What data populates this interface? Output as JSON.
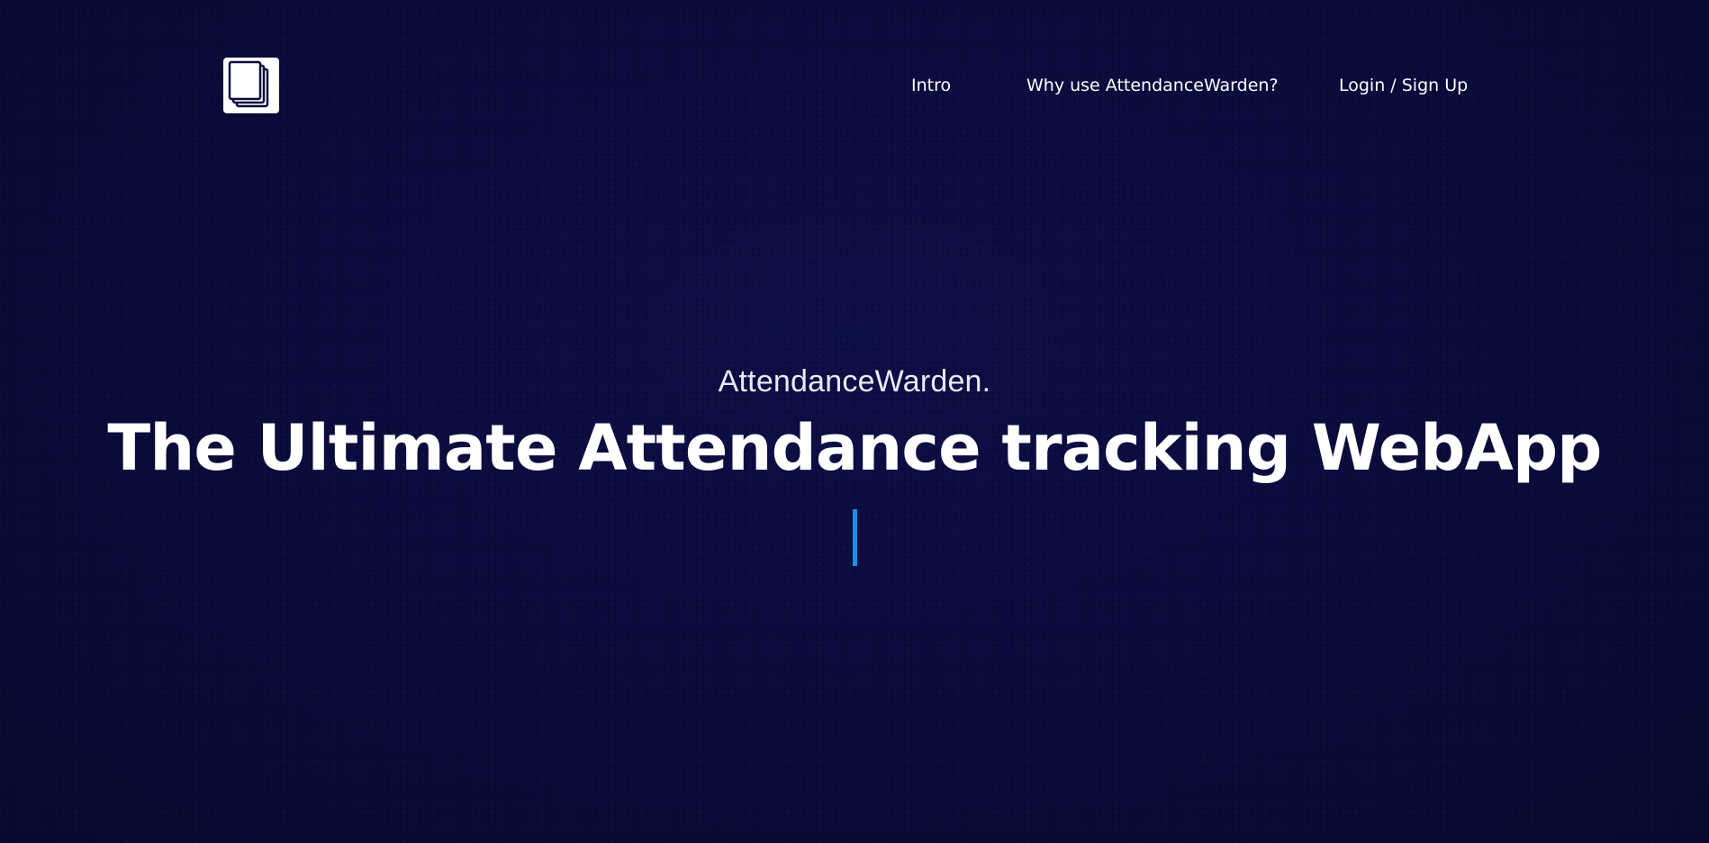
{
  "nav": {
    "logo_icon": "stacked-pages-icon",
    "items": [
      {
        "label": "Intro"
      },
      {
        "label": "Why use AttendanceWarden?"
      },
      {
        "label": "Login / Sign Up"
      }
    ]
  },
  "hero": {
    "brand": "AttendanceWarden.",
    "title": "The Ultimate Attendance tracking WebApp",
    "cursor_icon": "text-cursor-bar"
  },
  "colors": {
    "background": "#0b0c3d",
    "text": "#ffffff",
    "accent": "#1e8fe0"
  }
}
